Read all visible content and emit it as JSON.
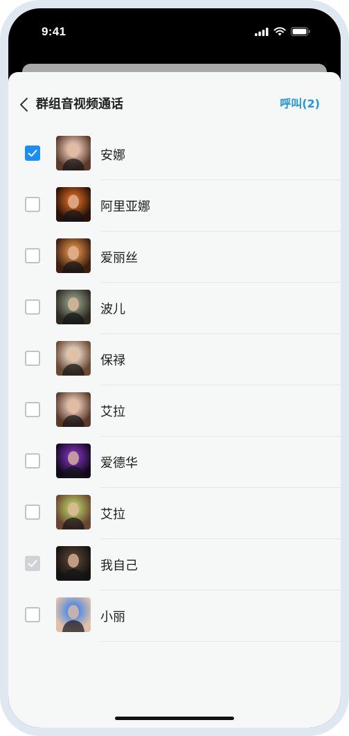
{
  "status_bar": {
    "time": "9:41",
    "icons": [
      "cellular-signal-icon",
      "wifi-icon",
      "battery-icon"
    ]
  },
  "header": {
    "title": "群组音视频通话",
    "call_label": "呼叫(2)",
    "back_icon": "chevron-left-icon"
  },
  "accent_color": "#1a8ff2",
  "contacts": [
    {
      "name": "安娜",
      "state": "checked",
      "avatar_colors": [
        "#d8b7a6",
        "#5a3a2a"
      ]
    },
    {
      "name": "阿里亚娜",
      "state": "unchecked",
      "avatar_colors": [
        "#b85a1c",
        "#2a1208"
      ]
    },
    {
      "name": "爱丽丝",
      "state": "unchecked",
      "avatar_colors": [
        "#c27a3e",
        "#3d2010"
      ]
    },
    {
      "name": "波儿",
      "state": "unchecked",
      "avatar_colors": [
        "#7d8a74",
        "#2e2a22"
      ]
    },
    {
      "name": "保禄",
      "state": "unchecked",
      "avatar_colors": [
        "#d9c6b5",
        "#6b4a33"
      ]
    },
    {
      "name": "艾拉",
      "state": "unchecked",
      "avatar_colors": [
        "#d8b7a6",
        "#5a3a2a"
      ]
    },
    {
      "name": "爱德华",
      "state": "unchecked",
      "avatar_colors": [
        "#6a2a9c",
        "#140a20"
      ]
    },
    {
      "name": "艾拉",
      "state": "unchecked",
      "avatar_colors": [
        "#a8b45a",
        "#6a4530"
      ]
    },
    {
      "name": "我自己",
      "state": "disabled-checked",
      "avatar_colors": [
        "#4a3a2c",
        "#161210"
      ]
    },
    {
      "name": "小丽",
      "state": "unchecked",
      "avatar_colors": [
        "#5a8ee0",
        "#e0c0a8"
      ]
    }
  ]
}
